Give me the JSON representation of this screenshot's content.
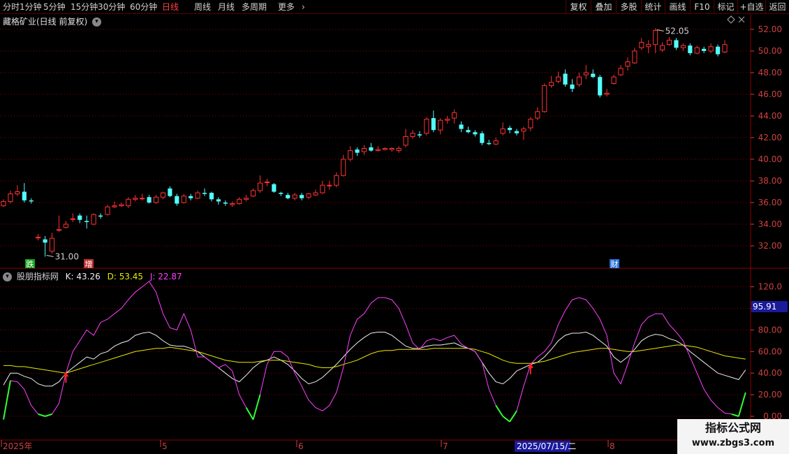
{
  "toolbar": {
    "periods": [
      "分时",
      "1分钟",
      "5分钟",
      "15分钟",
      "30分钟",
      "60分钟",
      "日线",
      "周线",
      "月线",
      "多周期",
      "更多"
    ],
    "active_period": "日线",
    "more_arrow": "›",
    "actions": [
      "复权",
      "叠加",
      "多股",
      "统计",
      "画线",
      "F10",
      "标记",
      "+自选",
      "返回"
    ]
  },
  "price_panel": {
    "title": "藏格矿业(日线 前复权)",
    "high_label": "52.05",
    "low_label": "31.00",
    "markers": [
      "跌",
      "增",
      "财"
    ],
    "y_ticks": [
      "52.00",
      "50.00",
      "48.00",
      "46.00",
      "44.00",
      "42.00",
      "40.00",
      "38.00",
      "36.00",
      "34.00",
      "32.00"
    ]
  },
  "indicator_panel": {
    "title": "股朋指标网",
    "k_label": "K: 43.26",
    "d_label": "D: 53.45",
    "j_label": "J: 22.87",
    "current_tag": "95.91",
    "y_ticks": [
      "120.0",
      "100.0",
      "80.00",
      "60.00",
      "40.00",
      "20.00",
      "0.00"
    ]
  },
  "x_axis": {
    "labels": [
      "2025年",
      "5",
      "6",
      "7",
      "8"
    ],
    "cursor_date": "2025/07/15/二"
  },
  "watermark": {
    "line1": "指标公式网",
    "line2": "www.zbgs3.com"
  },
  "colors": {
    "up": "#ff3232",
    "down": "#54fcfc",
    "k_line": "#f0f0f0",
    "d_line": "#e8e800",
    "j_line": "#ff40ff",
    "grid": "#8b0000",
    "axis_text": "#d04040",
    "active_period": "#ff4040",
    "signal_arrow": "#ff2020"
  },
  "chart_data": {
    "type": "candlestick",
    "title": "藏格矿业(日线 前复权)",
    "ylim": [
      31,
      53
    ],
    "candles": [
      {
        "o": 35.7,
        "c": 36.1,
        "h": 36.3,
        "l": 35.6
      },
      {
        "o": 36.1,
        "c": 36.8,
        "h": 37.1,
        "l": 35.9
      },
      {
        "o": 36.8,
        "c": 37.0,
        "h": 37.6,
        "l": 36.6
      },
      {
        "o": 37.0,
        "c": 36.2,
        "h": 37.8,
        "l": 36.0
      },
      {
        "o": 36.2,
        "c": 36.1,
        "h": 36.4,
        "l": 35.9
      },
      {
        "o": 32.8,
        "c": 32.8,
        "h": 33.1,
        "l": 32.5
      },
      {
        "o": 32.6,
        "c": 32.3,
        "h": 32.9,
        "l": 31.0
      },
      {
        "o": 31.5,
        "c": 32.7,
        "h": 33.2,
        "l": 31.3
      },
      {
        "o": 33.5,
        "c": 33.5,
        "h": 34.8,
        "l": 33.3
      },
      {
        "o": 33.7,
        "c": 34.0,
        "h": 34.3,
        "l": 33.6
      },
      {
        "o": 34.5,
        "c": 34.5,
        "h": 35.0,
        "l": 34.2
      },
      {
        "o": 34.8,
        "c": 34.4,
        "h": 35.0,
        "l": 34.1
      },
      {
        "o": 34.3,
        "c": 34.2,
        "h": 34.8,
        "l": 33.6
      },
      {
        "o": 34.0,
        "c": 34.9,
        "h": 35.0,
        "l": 33.9
      },
      {
        "o": 34.8,
        "c": 34.7,
        "h": 35.0,
        "l": 34.5
      },
      {
        "o": 34.9,
        "c": 35.6,
        "h": 35.8,
        "l": 34.8
      },
      {
        "o": 35.6,
        "c": 35.7,
        "h": 36.1,
        "l": 35.5
      },
      {
        "o": 35.7,
        "c": 35.8,
        "h": 36.0,
        "l": 35.6
      },
      {
        "o": 35.7,
        "c": 36.3,
        "h": 36.5,
        "l": 35.5
      },
      {
        "o": 36.3,
        "c": 36.4,
        "h": 36.7,
        "l": 36.1
      },
      {
        "o": 36.4,
        "c": 36.4,
        "h": 36.8,
        "l": 36.2
      },
      {
        "o": 36.5,
        "c": 36.0,
        "h": 36.7,
        "l": 35.9
      },
      {
        "o": 36.0,
        "c": 36.5,
        "h": 36.7,
        "l": 35.9
      },
      {
        "o": 36.5,
        "c": 36.9,
        "h": 37.0,
        "l": 36.3
      },
      {
        "o": 37.3,
        "c": 36.6,
        "h": 37.5,
        "l": 36.5
      },
      {
        "o": 36.6,
        "c": 35.9,
        "h": 36.8,
        "l": 35.7
      },
      {
        "o": 36.0,
        "c": 36.6,
        "h": 36.8,
        "l": 35.9
      },
      {
        "o": 36.6,
        "c": 36.4,
        "h": 36.8,
        "l": 36.2
      },
      {
        "o": 36.4,
        "c": 36.9,
        "h": 37.1,
        "l": 36.3
      },
      {
        "o": 36.9,
        "c": 36.8,
        "h": 37.3,
        "l": 36.6
      },
      {
        "o": 36.9,
        "c": 36.3,
        "h": 37.0,
        "l": 36.1
      },
      {
        "o": 36.3,
        "c": 36.1,
        "h": 36.5,
        "l": 35.8
      },
      {
        "o": 36.0,
        "c": 35.9,
        "h": 36.2,
        "l": 35.7
      },
      {
        "o": 35.8,
        "c": 35.9,
        "h": 36.1,
        "l": 35.6
      },
      {
        "o": 35.9,
        "c": 36.3,
        "h": 36.5,
        "l": 35.8
      },
      {
        "o": 36.3,
        "c": 36.4,
        "h": 36.7,
        "l": 36.1
      },
      {
        "o": 36.6,
        "c": 37.1,
        "h": 37.3,
        "l": 36.5
      },
      {
        "o": 37.1,
        "c": 37.8,
        "h": 38.5,
        "l": 36.9
      },
      {
        "o": 37.9,
        "c": 37.9,
        "h": 38.2,
        "l": 37.5
      },
      {
        "o": 37.7,
        "c": 37.0,
        "h": 37.8,
        "l": 36.9
      },
      {
        "o": 36.9,
        "c": 36.8,
        "h": 37.0,
        "l": 36.6
      },
      {
        "o": 36.7,
        "c": 36.4,
        "h": 36.9,
        "l": 36.3
      },
      {
        "o": 36.4,
        "c": 36.7,
        "h": 36.9,
        "l": 36.2
      },
      {
        "o": 36.7,
        "c": 36.4,
        "h": 36.9,
        "l": 36.2
      },
      {
        "o": 36.5,
        "c": 36.8,
        "h": 36.9,
        "l": 36.3
      },
      {
        "o": 36.7,
        "c": 36.9,
        "h": 37.2,
        "l": 36.6
      },
      {
        "o": 36.9,
        "c": 37.6,
        "h": 38.0,
        "l": 36.8
      },
      {
        "o": 37.6,
        "c": 37.6,
        "h": 38.0,
        "l": 37.2
      },
      {
        "o": 37.6,
        "c": 38.5,
        "h": 38.8,
        "l": 37.4
      },
      {
        "o": 38.5,
        "c": 40.0,
        "h": 40.4,
        "l": 38.4
      },
      {
        "o": 40.0,
        "c": 40.8,
        "h": 41.2,
        "l": 39.8
      },
      {
        "o": 40.9,
        "c": 40.6,
        "h": 41.1,
        "l": 40.3
      },
      {
        "o": 40.7,
        "c": 41.0,
        "h": 41.3,
        "l": 40.4
      },
      {
        "o": 41.1,
        "c": 40.8,
        "h": 41.5,
        "l": 40.7
      },
      {
        "o": 40.8,
        "c": 40.9,
        "h": 41.2,
        "l": 40.7
      },
      {
        "o": 40.9,
        "c": 41.0,
        "h": 41.1,
        "l": 40.8
      },
      {
        "o": 40.9,
        "c": 41.0,
        "h": 41.1,
        "l": 40.7
      },
      {
        "o": 40.8,
        "c": 41.0,
        "h": 41.2,
        "l": 40.6
      },
      {
        "o": 41.3,
        "c": 42.1,
        "h": 42.8,
        "l": 41.1
      },
      {
        "o": 42.1,
        "c": 42.4,
        "h": 42.7,
        "l": 41.9
      },
      {
        "o": 42.3,
        "c": 42.2,
        "h": 42.6,
        "l": 42.0
      },
      {
        "o": 42.4,
        "c": 43.7,
        "h": 43.9,
        "l": 42.2
      },
      {
        "o": 43.8,
        "c": 42.7,
        "h": 44.5,
        "l": 42.5
      },
      {
        "o": 42.7,
        "c": 43.6,
        "h": 43.8,
        "l": 42.3
      },
      {
        "o": 43.6,
        "c": 43.7,
        "h": 44.0,
        "l": 43.3
      },
      {
        "o": 43.8,
        "c": 44.3,
        "h": 44.6,
        "l": 43.3
      },
      {
        "o": 43.2,
        "c": 42.8,
        "h": 43.5,
        "l": 42.5
      },
      {
        "o": 42.7,
        "c": 42.5,
        "h": 43.0,
        "l": 42.4
      },
      {
        "o": 42.5,
        "c": 42.3,
        "h": 42.7,
        "l": 42.1
      },
      {
        "o": 42.4,
        "c": 41.5,
        "h": 42.6,
        "l": 41.3
      },
      {
        "o": 41.5,
        "c": 41.4,
        "h": 41.8,
        "l": 41.3
      },
      {
        "o": 41.4,
        "c": 41.7,
        "h": 42.0,
        "l": 41.3
      },
      {
        "o": 42.4,
        "c": 42.8,
        "h": 43.4,
        "l": 42.2
      },
      {
        "o": 42.9,
        "c": 42.7,
        "h": 43.1,
        "l": 42.4
      },
      {
        "o": 42.6,
        "c": 42.4,
        "h": 42.8,
        "l": 42.2
      },
      {
        "o": 42.6,
        "c": 42.8,
        "h": 43.0,
        "l": 41.8
      },
      {
        "o": 42.9,
        "c": 43.7,
        "h": 43.9,
        "l": 42.6
      },
      {
        "o": 43.8,
        "c": 44.4,
        "h": 44.8,
        "l": 43.6
      },
      {
        "o": 44.4,
        "c": 46.8,
        "h": 47.0,
        "l": 44.3
      },
      {
        "o": 46.8,
        "c": 47.1,
        "h": 47.7,
        "l": 46.6
      },
      {
        "o": 47.2,
        "c": 47.6,
        "h": 48.1,
        "l": 47.0
      },
      {
        "o": 47.9,
        "c": 46.9,
        "h": 48.3,
        "l": 46.7
      },
      {
        "o": 46.9,
        "c": 46.5,
        "h": 47.4,
        "l": 46.2
      },
      {
        "o": 46.9,
        "c": 47.6,
        "h": 48.0,
        "l": 46.7
      },
      {
        "o": 47.8,
        "c": 48.0,
        "h": 48.7,
        "l": 47.4
      },
      {
        "o": 47.9,
        "c": 47.6,
        "h": 48.3,
        "l": 47.5
      },
      {
        "o": 47.6,
        "c": 45.9,
        "h": 47.8,
        "l": 45.7
      },
      {
        "o": 46.0,
        "c": 46.1,
        "h": 46.5,
        "l": 45.8
      },
      {
        "o": 47.0,
        "c": 47.6,
        "h": 47.8,
        "l": 46.9
      },
      {
        "o": 47.8,
        "c": 48.4,
        "h": 48.7,
        "l": 47.7
      },
      {
        "o": 48.6,
        "c": 49.0,
        "h": 49.4,
        "l": 48.2
      },
      {
        "o": 48.9,
        "c": 50.0,
        "h": 50.3,
        "l": 48.8
      },
      {
        "o": 50.3,
        "c": 50.8,
        "h": 51.2,
        "l": 50.1
      },
      {
        "o": 50.4,
        "c": 50.6,
        "h": 51.0,
        "l": 49.8
      },
      {
        "o": 50.6,
        "c": 51.9,
        "h": 52.1,
        "l": 49.8
      },
      {
        "o": 50.1,
        "c": 50.5,
        "h": 50.8,
        "l": 49.9
      },
      {
        "o": 50.6,
        "c": 51.0,
        "h": 51.3,
        "l": 50.5
      },
      {
        "o": 51.0,
        "c": 50.3,
        "h": 51.2,
        "l": 50.1
      },
      {
        "o": 50.3,
        "c": 50.5,
        "h": 50.7,
        "l": 50.0
      },
      {
        "o": 50.5,
        "c": 49.8,
        "h": 50.7,
        "l": 49.6
      },
      {
        "o": 49.8,
        "c": 50.3,
        "h": 50.5,
        "l": 49.7
      },
      {
        "o": 50.2,
        "c": 50.0,
        "h": 50.4,
        "l": 49.8
      },
      {
        "o": 50.0,
        "c": 50.4,
        "h": 50.7,
        "l": 49.8
      },
      {
        "o": 50.4,
        "c": 49.7,
        "h": 50.6,
        "l": 49.5
      },
      {
        "o": 49.9,
        "c": 50.6,
        "h": 51.0,
        "l": 49.8
      }
    ],
    "indicator": {
      "ylim": [
        -5,
        135
      ],
      "series": [
        {
          "name": "K",
          "values": [
            29,
            40,
            40,
            37,
            35,
            30,
            28,
            28,
            32,
            40,
            45,
            50,
            55,
            53,
            58,
            60,
            65,
            68,
            70,
            75,
            77,
            78,
            75,
            70,
            66,
            65,
            65,
            63,
            60,
            55,
            50,
            45,
            40,
            35,
            32,
            38,
            45,
            50,
            52,
            55,
            52,
            48,
            42,
            35,
            30,
            32,
            36,
            42,
            48,
            55,
            62,
            68,
            73,
            77,
            78,
            78,
            75,
            70,
            65,
            63,
            63,
            65,
            66,
            66,
            67,
            68,
            65,
            63,
            60,
            50,
            40,
            32,
            30,
            35,
            42,
            45,
            48,
            50,
            55,
            62,
            70,
            75,
            77,
            77,
            78,
            75,
            70,
            65,
            55,
            50,
            55,
            62,
            70,
            74,
            76,
            75,
            72,
            70,
            66,
            60,
            55,
            50,
            45,
            40,
            38,
            36,
            34,
            43
          ]
        },
        {
          "name": "D",
          "values": [
            47,
            47,
            46,
            46,
            45,
            44,
            43,
            42,
            41,
            40,
            42,
            44,
            46,
            48,
            50,
            52,
            54,
            56,
            58,
            60,
            61,
            62,
            63,
            63,
            64,
            63,
            62,
            61,
            60,
            58,
            56,
            54,
            52,
            51,
            50,
            50,
            50,
            51,
            52,
            52,
            52,
            51,
            50,
            49,
            48,
            46,
            45,
            45,
            46,
            48,
            50,
            52,
            55,
            58,
            60,
            61,
            61,
            62,
            62,
            62,
            62,
            62,
            63,
            63,
            63,
            63,
            63,
            63,
            62,
            60,
            58,
            55,
            52,
            50,
            49,
            49,
            49,
            50,
            51,
            53,
            55,
            57,
            59,
            60,
            61,
            62,
            63,
            63,
            62,
            61,
            60,
            60,
            61,
            62,
            63,
            64,
            65,
            66,
            66,
            65,
            64,
            62,
            60,
            58,
            56,
            55,
            54,
            53
          ]
        },
        {
          "name": "J",
          "values": [
            -3,
            33,
            32,
            25,
            10,
            2,
            0,
            2,
            12,
            40,
            60,
            70,
            80,
            75,
            87,
            90,
            95,
            100,
            108,
            115,
            120,
            125,
            115,
            95,
            82,
            80,
            95,
            80,
            55,
            55,
            50,
            45,
            48,
            42,
            20,
            8,
            -3,
            20,
            48,
            60,
            60,
            55,
            40,
            28,
            15,
            8,
            5,
            10,
            22,
            45,
            75,
            90,
            95,
            105,
            110,
            110,
            108,
            100,
            85,
            68,
            62,
            70,
            72,
            70,
            73,
            75,
            67,
            63,
            60,
            50,
            25,
            10,
            0,
            -5,
            5,
            28,
            48,
            55,
            60,
            68,
            85,
            98,
            108,
            110,
            108,
            100,
            90,
            75,
            40,
            30,
            48,
            68,
            85,
            92,
            95,
            95,
            85,
            78,
            70,
            55,
            40,
            25,
            15,
            8,
            3,
            2,
            0,
            22
          ]
        }
      ]
    }
  }
}
